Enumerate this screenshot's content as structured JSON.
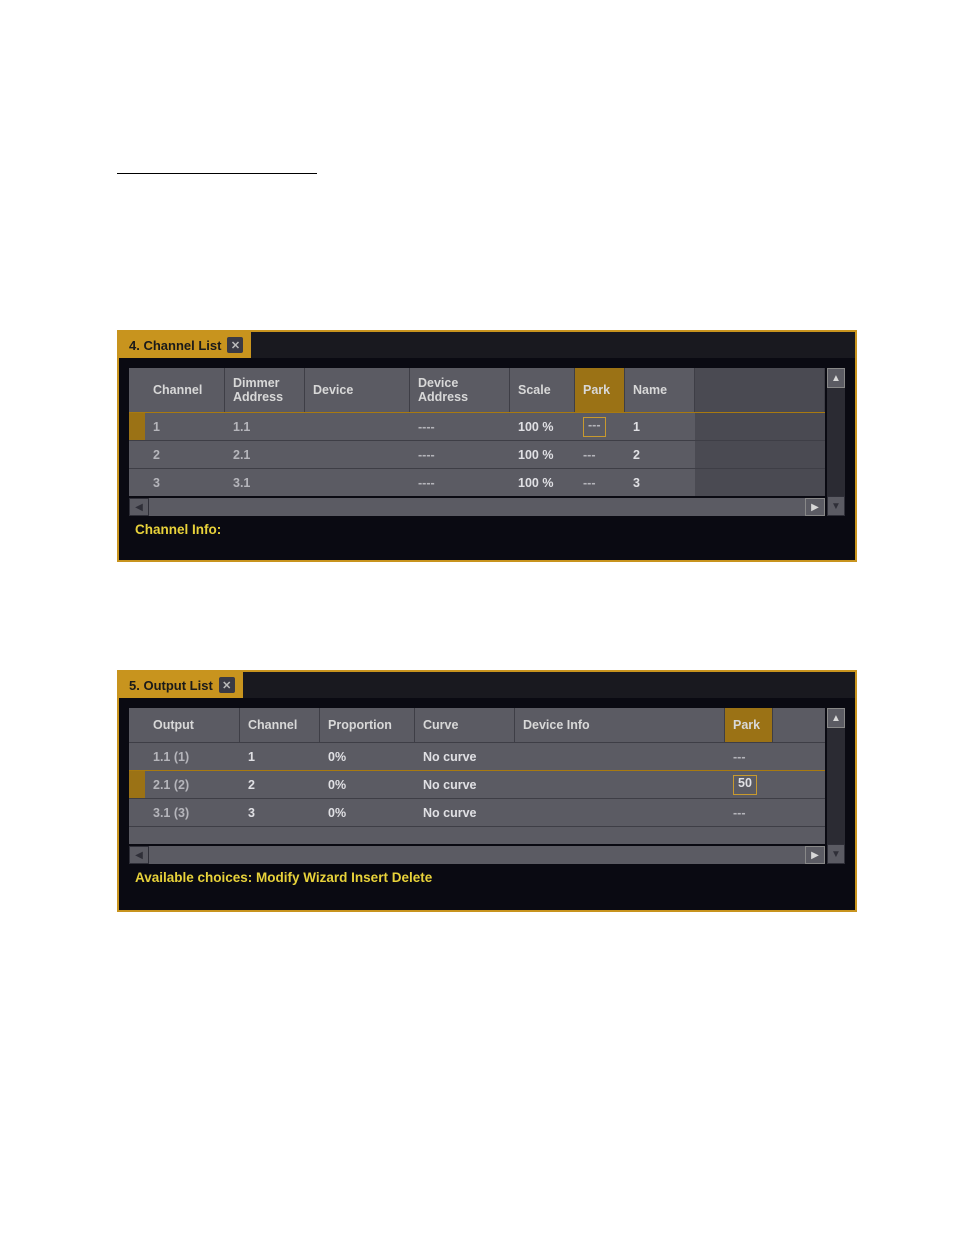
{
  "underline": {
    "present": true
  },
  "link1": {
    "text": " "
  },
  "link2": {
    "text": " "
  },
  "channel_list_panel": {
    "tab_label": "4. Channel List",
    "headers": {
      "channel": "Channel",
      "dimmer_address": "Dimmer Address",
      "device": "Device",
      "device_address": "Device Address",
      "scale": "Scale",
      "park": "Park",
      "name": "Name"
    },
    "selected_header": "park",
    "rows": [
      {
        "selected": true,
        "channel": "1",
        "dimmer_address": "1.1",
        "device": "",
        "device_address": "----",
        "scale": "100 %",
        "park": "---",
        "name": "1"
      },
      {
        "selected": false,
        "channel": "2",
        "dimmer_address": "2.1",
        "device": "",
        "device_address": "----",
        "scale": "100 %",
        "park": "---",
        "name": "2"
      },
      {
        "selected": false,
        "channel": "3",
        "dimmer_address": "3.1",
        "device": "",
        "device_address": "----",
        "scale": "100 %",
        "park": "---",
        "name": "3"
      }
    ],
    "selected_row_index": 0,
    "footer": "Channel Info:"
  },
  "output_list_panel": {
    "tab_label": "5. Output List",
    "headers": {
      "output": "Output",
      "channel": "Channel",
      "proportion": "Proportion",
      "curve": "Curve",
      "device_info": "Device Info",
      "park": "Park"
    },
    "selected_header": "park",
    "rows": [
      {
        "selected": false,
        "output": "1.1 (1)",
        "channel": "1",
        "proportion": "0%",
        "curve": "No curve",
        "device_info": "",
        "park": "---"
      },
      {
        "selected": true,
        "output": "2.1 (2)",
        "channel": "2",
        "proportion": "0%",
        "curve": "No curve",
        "device_info": "",
        "park": "50"
      },
      {
        "selected": false,
        "output": "3.1 (3)",
        "channel": "3",
        "proportion": "0%",
        "curve": "No curve",
        "device_info": "",
        "park": "---"
      }
    ],
    "selected_row_index": 1,
    "footer": "Available choices: Modify Wizard Insert Delete"
  }
}
